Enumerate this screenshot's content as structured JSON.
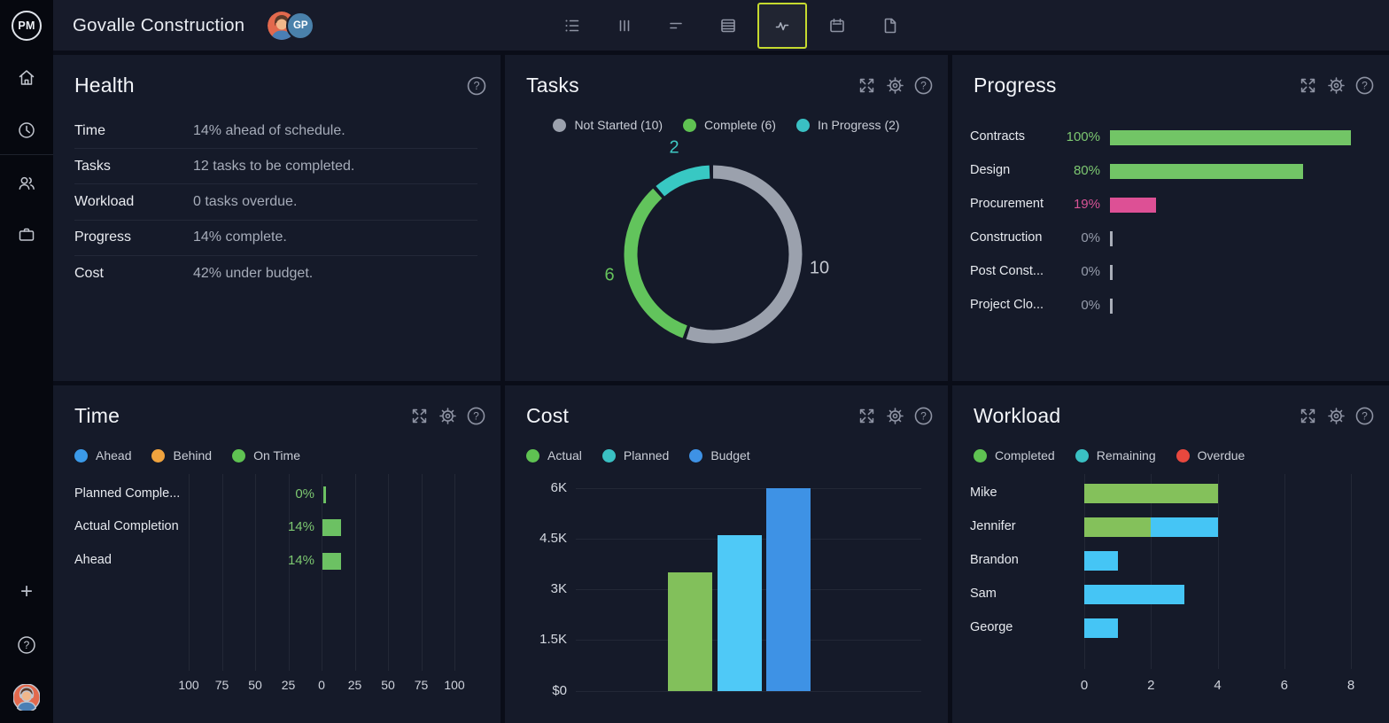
{
  "topbar": {
    "logo_text": "PM",
    "title": "Govalle Construction",
    "avatar_initials": "GP",
    "toolbar_icons": [
      "list-icon",
      "board-icon",
      "gantt-icon",
      "sheet-icon",
      "dashboard-icon",
      "calendar-icon",
      "document-icon"
    ],
    "active_icon": "dashboard-icon",
    "active_border_color": "#c6da2f"
  },
  "panels": {
    "health": {
      "title": "Health",
      "rows": [
        {
          "label": "Time",
          "value": "14% ahead of schedule."
        },
        {
          "label": "Tasks",
          "value": "12 tasks to be completed."
        },
        {
          "label": "Workload",
          "value": "0 tasks overdue."
        },
        {
          "label": "Progress",
          "value": "14% complete."
        },
        {
          "label": "Cost",
          "value": "42% under budget."
        }
      ]
    },
    "tasks": {
      "title": "Tasks",
      "legend": [
        {
          "label": "Not Started (10)",
          "color": "#9ba1ad"
        },
        {
          "label": "Complete (6)",
          "color": "#5fc252"
        },
        {
          "label": "In Progress (2)",
          "color": "#3ac0c3"
        }
      ],
      "chart_data": {
        "type": "pie",
        "total": 18,
        "segments": [
          {
            "name": "Not Started",
            "value": 10,
            "color": "#9ba1ad",
            "label": "10",
            "label_color": "#c3c7d0"
          },
          {
            "name": "Complete",
            "value": 6,
            "color": "#62c45c",
            "label": "6",
            "label_color": "#66c35c"
          },
          {
            "name": "In Progress",
            "value": 2,
            "color": "#38c8c3",
            "label": "2",
            "label_color": "#3fc9c4"
          }
        ],
        "legend_position": "top"
      }
    },
    "progress": {
      "title": "Progress",
      "chart_data": {
        "type": "bar",
        "orientation": "horizontal",
        "categories": [
          "Contracts",
          "Design",
          "Procurement",
          "Construction",
          "Post Const...",
          "Project Clo..."
        ],
        "values": [
          100,
          80,
          19,
          0,
          0,
          0
        ],
        "value_labels": [
          "100%",
          "80%",
          "19%",
          "0%",
          "0%",
          "0%"
        ],
        "bar_colors": [
          "#72c566",
          "#72c566",
          "#dd5095",
          null,
          null,
          null
        ],
        "value_colors": [
          "#7dc871",
          "#7dc871",
          "#d85396",
          "#969cab",
          "#969cab",
          "#969cab"
        ],
        "xlim": [
          0,
          100
        ],
        "grid": false
      }
    },
    "time": {
      "title": "Time",
      "legend": [
        {
          "label": "Ahead",
          "color": "#3b9ae9"
        },
        {
          "label": "Behind",
          "color": "#f0a33e"
        },
        {
          "label": "On Time",
          "color": "#5fc252"
        }
      ],
      "chart_data": {
        "type": "bar",
        "orientation": "horizontal",
        "categories": [
          "Planned Comple...",
          "Actual Completion",
          "Ahead"
        ],
        "values": [
          0,
          14,
          14
        ],
        "value_labels": [
          "0%",
          "14%",
          "14%"
        ],
        "bar_color": "#6cc163",
        "value_color": "#7dc871",
        "axis_ticks": [
          "100",
          "75",
          "50",
          "25",
          "0",
          "25",
          "50",
          "75",
          "100"
        ],
        "xlim": [
          -100,
          100
        ],
        "grid": true
      }
    },
    "cost": {
      "title": "Cost",
      "legend": [
        {
          "label": "Actual",
          "color": "#5fc252"
        },
        {
          "label": "Planned",
          "color": "#3ac0c3"
        },
        {
          "label": "Budget",
          "color": "#3e92e5"
        }
      ],
      "chart_data": {
        "type": "bar",
        "orientation": "vertical",
        "series": [
          {
            "name": "Actual",
            "value": 3500,
            "color": "#82c05b"
          },
          {
            "name": "Planned",
            "value": 4600,
            "color": "#4fc9f7"
          },
          {
            "name": "Budget",
            "value": 6000,
            "color": "#3e92e5"
          }
        ],
        "y_ticks": [
          "6K",
          "4.5K",
          "3K",
          "1.5K",
          "$0"
        ],
        "y_tick_values": [
          6000,
          4500,
          3000,
          1500,
          0
        ],
        "ylim": [
          0,
          6000
        ],
        "grid": true
      }
    },
    "workload": {
      "title": "Workload",
      "legend": [
        {
          "label": "Completed",
          "color": "#5fc252"
        },
        {
          "label": "Remaining",
          "color": "#3ac0c3"
        },
        {
          "label": "Overdue",
          "color": "#e8483e"
        }
      ],
      "chart_data": {
        "type": "bar",
        "orientation": "horizontal",
        "stacked": true,
        "categories": [
          "Mike",
          "Jennifer",
          "Brandon",
          "Sam",
          "George"
        ],
        "series": [
          {
            "name": "Completed",
            "color": "#84c15b",
            "values": [
              4,
              2,
              0,
              0,
              0
            ]
          },
          {
            "name": "Remaining",
            "color": "#45c5f5",
            "values": [
              0,
              2,
              1,
              3,
              1
            ]
          }
        ],
        "x_ticks": [
          "0",
          "2",
          "4",
          "6",
          "8"
        ],
        "x_tick_values": [
          0,
          2,
          4,
          6,
          8
        ],
        "xlim": [
          0,
          8
        ],
        "grid": true
      }
    }
  },
  "icons": {
    "expand": "expand-icon",
    "settings": "gear-icon",
    "help": "help-icon"
  }
}
